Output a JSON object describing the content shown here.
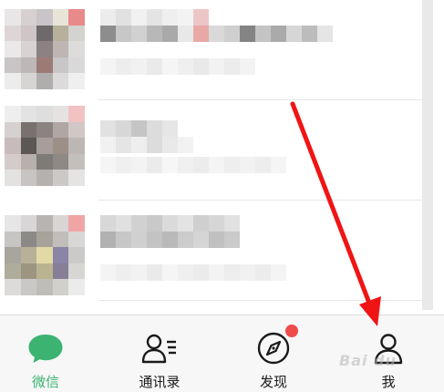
{
  "tabbar": {
    "tabs": [
      {
        "label": "微信",
        "icon": "chat-bubble-icon",
        "active": true
      },
      {
        "label": "通讯录",
        "icon": "contacts-icon",
        "active": false
      },
      {
        "label": "发现",
        "icon": "compass-icon",
        "active": false,
        "badge": true
      },
      {
        "label": "我",
        "icon": "person-icon",
        "active": false
      }
    ]
  },
  "colors": {
    "accent": "#3cb371",
    "badge": "#f04b4b",
    "arrow": "#f01414"
  },
  "watermark": "Bai du"
}
